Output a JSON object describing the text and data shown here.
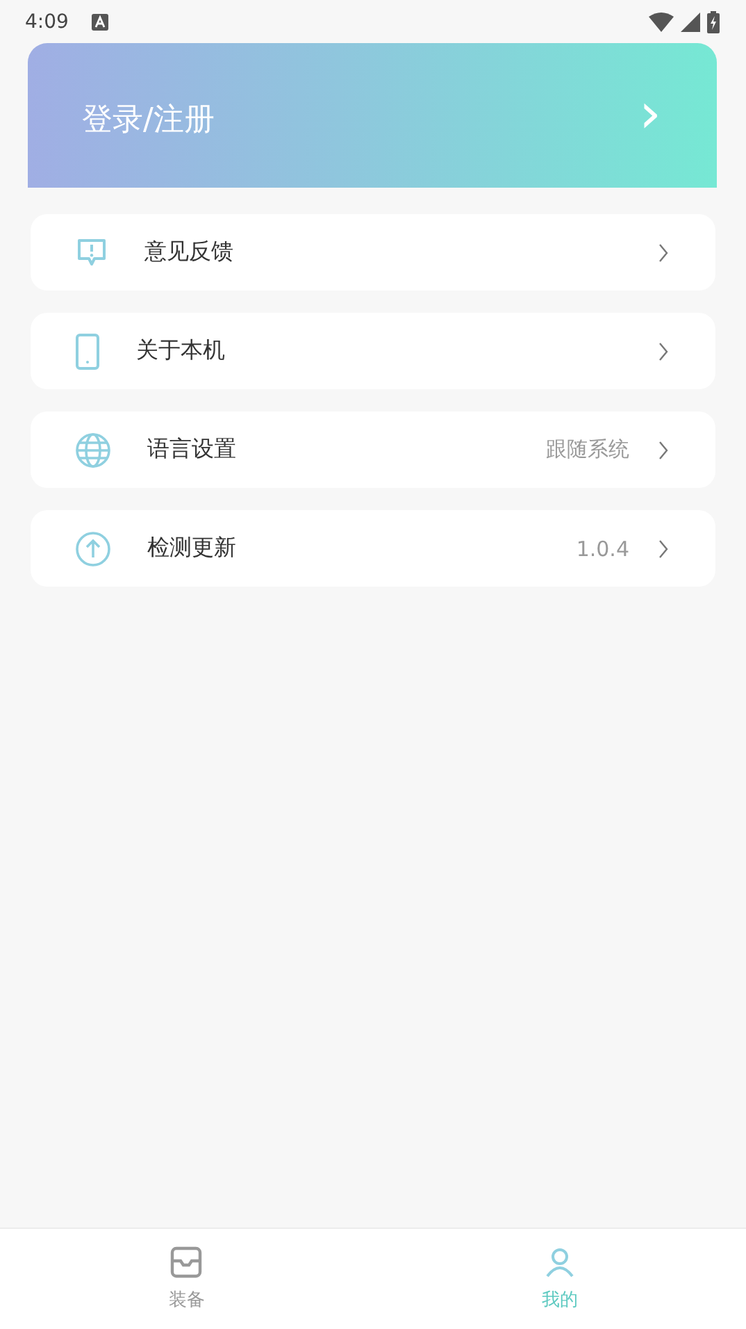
{
  "status_bar": {
    "time": "4:09"
  },
  "login_banner": {
    "label": "登录/注册",
    "chevron": "›"
  },
  "menu_items": [
    {
      "kind": "feedback",
      "label": "意见反馈"
    },
    {
      "kind": "device",
      "label": "关于本机"
    },
    {
      "kind": "language",
      "label": "语言设置",
      "value": "跟随系统"
    },
    {
      "kind": "update",
      "label": "检测更新",
      "value": "1.0.4"
    }
  ],
  "bottom_nav": [
    {
      "kind": "equipment",
      "label": "装备",
      "selected": false
    },
    {
      "kind": "profile",
      "label": "我的",
      "selected": true
    }
  ]
}
